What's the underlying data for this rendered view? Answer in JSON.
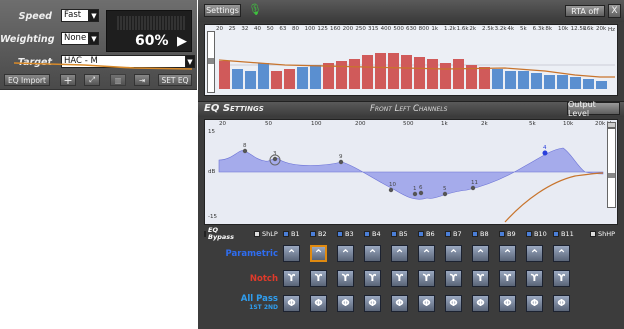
{
  "left": {
    "speed_label": "Speed",
    "speed_value": "Fast",
    "weighting_label": "Weighting",
    "weighting_value": "None",
    "target_label": "Target",
    "target_value": "HAC - M",
    "percent": "60%",
    "buttons": {
      "eq_import": "EQ Import",
      "set_eq": "SET EQ"
    }
  },
  "rta": {
    "settings_label": "Settings",
    "rta_toggle": "RTA off",
    "close": "X",
    "freq_ticks": [
      "20",
      "25",
      "32",
      "40",
      "50",
      "63",
      "80",
      "100",
      "125",
      "160",
      "200",
      "250",
      "315",
      "400",
      "500",
      "630",
      "800",
      "1k",
      "1.2k",
      "1.6k",
      "2k",
      "2.5k",
      "3.2k",
      "4k",
      "5k",
      "6.3k",
      "8k",
      "10k",
      "12.5k",
      "16k",
      "20k"
    ],
    "hz": "Hz"
  },
  "eq": {
    "title": "EQ Settings",
    "channel": "Front Left Channels",
    "output_level": "Output Level",
    "freq_ticks": [
      "20",
      "50",
      "100",
      "200",
      "500",
      "1k",
      "2k",
      "5k",
      "10k",
      "20k"
    ],
    "hz": "Hz",
    "y_top": "15",
    "y_mid": "dB",
    "y_bot": "-15",
    "band_points": [
      "8",
      "3",
      "9",
      "10",
      "1",
      "6",
      "5",
      "11",
      "4"
    ],
    "bypass": "EQ Bypass",
    "shlp": "ShLP",
    "shhp": "ShHP",
    "bands": [
      "B1",
      "B2",
      "B3",
      "B4",
      "B5",
      "B6",
      "B7",
      "B8",
      "B9",
      "B10",
      "B11"
    ],
    "rows": {
      "parametric": "Parametric",
      "notch": "Notch",
      "allpass": "All Pass",
      "allpass_sub": "1ST 2ND"
    }
  },
  "colors": {
    "bar_red": "#d05a5a",
    "bar_blue": "#5a8fd0",
    "eq_fill": "#8f95e8",
    "accent": "#e08a10"
  }
}
